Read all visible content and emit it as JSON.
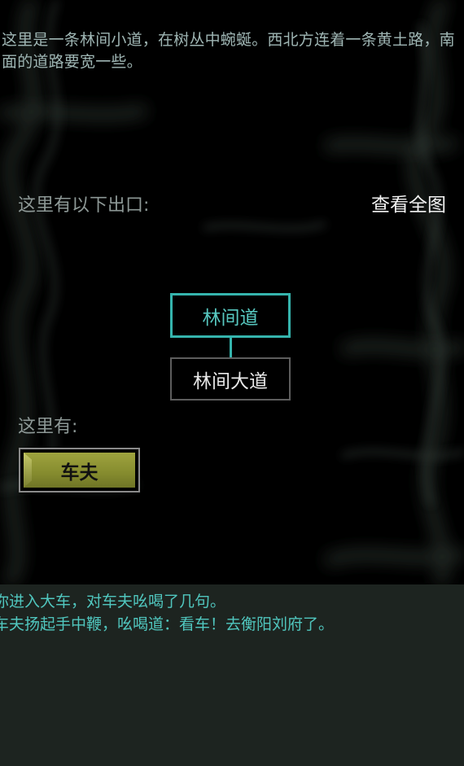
{
  "room": {
    "description": "这里是一条林间小道，在树丛中蜿蜒。西北方连着一条黄土路，南面的道路要宽一些。"
  },
  "exits": {
    "label": "这里有以下出口:",
    "view_map_label": "查看全图",
    "current_room": "林间道",
    "south_exit": "林间大道"
  },
  "here": {
    "label": "这里有:",
    "npcs": [
      "车夫"
    ]
  },
  "log": {
    "lines": [
      "你进入大车，对车夫吆喝了几句。",
      "车夫扬起手中鞭，吆喝道：看车！去衡阳刘府了。"
    ]
  },
  "colors": {
    "background": "#000000",
    "accent": "#35b4ad",
    "log_text": "#50c6be",
    "log_background": "#1d2420",
    "npc_button": "#8f9536"
  }
}
